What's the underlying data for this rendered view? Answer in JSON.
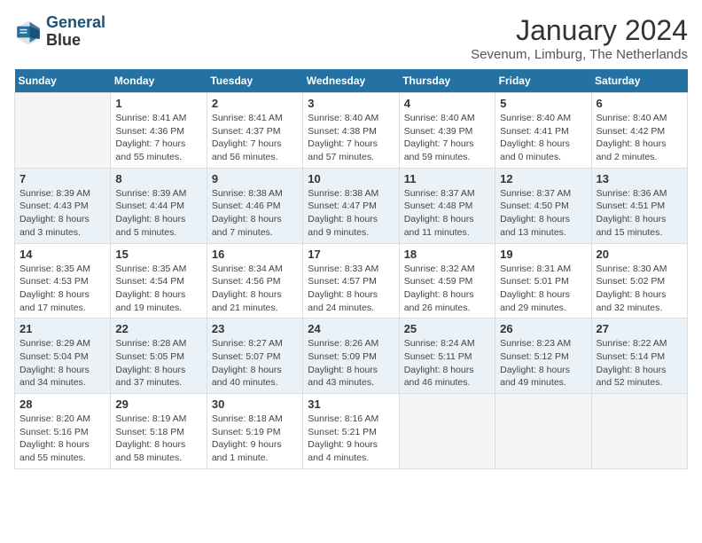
{
  "header": {
    "logo_line1": "General",
    "logo_line2": "Blue",
    "title": "January 2024",
    "subtitle": "Sevenum, Limburg, The Netherlands"
  },
  "days_of_week": [
    "Sunday",
    "Monday",
    "Tuesday",
    "Wednesday",
    "Thursday",
    "Friday",
    "Saturday"
  ],
  "weeks": [
    [
      {
        "day": "",
        "info": "",
        "empty": true
      },
      {
        "day": "1",
        "info": "Sunrise: 8:41 AM\nSunset: 4:36 PM\nDaylight: 7 hours\nand 55 minutes."
      },
      {
        "day": "2",
        "info": "Sunrise: 8:41 AM\nSunset: 4:37 PM\nDaylight: 7 hours\nand 56 minutes."
      },
      {
        "day": "3",
        "info": "Sunrise: 8:40 AM\nSunset: 4:38 PM\nDaylight: 7 hours\nand 57 minutes."
      },
      {
        "day": "4",
        "info": "Sunrise: 8:40 AM\nSunset: 4:39 PM\nDaylight: 7 hours\nand 59 minutes."
      },
      {
        "day": "5",
        "info": "Sunrise: 8:40 AM\nSunset: 4:41 PM\nDaylight: 8 hours\nand 0 minutes."
      },
      {
        "day": "6",
        "info": "Sunrise: 8:40 AM\nSunset: 4:42 PM\nDaylight: 8 hours\nand 2 minutes."
      }
    ],
    [
      {
        "day": "7",
        "info": "Sunrise: 8:39 AM\nSunset: 4:43 PM\nDaylight: 8 hours\nand 3 minutes."
      },
      {
        "day": "8",
        "info": "Sunrise: 8:39 AM\nSunset: 4:44 PM\nDaylight: 8 hours\nand 5 minutes."
      },
      {
        "day": "9",
        "info": "Sunrise: 8:38 AM\nSunset: 4:46 PM\nDaylight: 8 hours\nand 7 minutes."
      },
      {
        "day": "10",
        "info": "Sunrise: 8:38 AM\nSunset: 4:47 PM\nDaylight: 8 hours\nand 9 minutes."
      },
      {
        "day": "11",
        "info": "Sunrise: 8:37 AM\nSunset: 4:48 PM\nDaylight: 8 hours\nand 11 minutes."
      },
      {
        "day": "12",
        "info": "Sunrise: 8:37 AM\nSunset: 4:50 PM\nDaylight: 8 hours\nand 13 minutes."
      },
      {
        "day": "13",
        "info": "Sunrise: 8:36 AM\nSunset: 4:51 PM\nDaylight: 8 hours\nand 15 minutes."
      }
    ],
    [
      {
        "day": "14",
        "info": "Sunrise: 8:35 AM\nSunset: 4:53 PM\nDaylight: 8 hours\nand 17 minutes."
      },
      {
        "day": "15",
        "info": "Sunrise: 8:35 AM\nSunset: 4:54 PM\nDaylight: 8 hours\nand 19 minutes."
      },
      {
        "day": "16",
        "info": "Sunrise: 8:34 AM\nSunset: 4:56 PM\nDaylight: 8 hours\nand 21 minutes."
      },
      {
        "day": "17",
        "info": "Sunrise: 8:33 AM\nSunset: 4:57 PM\nDaylight: 8 hours\nand 24 minutes."
      },
      {
        "day": "18",
        "info": "Sunrise: 8:32 AM\nSunset: 4:59 PM\nDaylight: 8 hours\nand 26 minutes."
      },
      {
        "day": "19",
        "info": "Sunrise: 8:31 AM\nSunset: 5:01 PM\nDaylight: 8 hours\nand 29 minutes."
      },
      {
        "day": "20",
        "info": "Sunrise: 8:30 AM\nSunset: 5:02 PM\nDaylight: 8 hours\nand 32 minutes."
      }
    ],
    [
      {
        "day": "21",
        "info": "Sunrise: 8:29 AM\nSunset: 5:04 PM\nDaylight: 8 hours\nand 34 minutes."
      },
      {
        "day": "22",
        "info": "Sunrise: 8:28 AM\nSunset: 5:05 PM\nDaylight: 8 hours\nand 37 minutes."
      },
      {
        "day": "23",
        "info": "Sunrise: 8:27 AM\nSunset: 5:07 PM\nDaylight: 8 hours\nand 40 minutes."
      },
      {
        "day": "24",
        "info": "Sunrise: 8:26 AM\nSunset: 5:09 PM\nDaylight: 8 hours\nand 43 minutes."
      },
      {
        "day": "25",
        "info": "Sunrise: 8:24 AM\nSunset: 5:11 PM\nDaylight: 8 hours\nand 46 minutes."
      },
      {
        "day": "26",
        "info": "Sunrise: 8:23 AM\nSunset: 5:12 PM\nDaylight: 8 hours\nand 49 minutes."
      },
      {
        "day": "27",
        "info": "Sunrise: 8:22 AM\nSunset: 5:14 PM\nDaylight: 8 hours\nand 52 minutes."
      }
    ],
    [
      {
        "day": "28",
        "info": "Sunrise: 8:20 AM\nSunset: 5:16 PM\nDaylight: 8 hours\nand 55 minutes."
      },
      {
        "day": "29",
        "info": "Sunrise: 8:19 AM\nSunset: 5:18 PM\nDaylight: 8 hours\nand 58 minutes."
      },
      {
        "day": "30",
        "info": "Sunrise: 8:18 AM\nSunset: 5:19 PM\nDaylight: 9 hours\nand 1 minute."
      },
      {
        "day": "31",
        "info": "Sunrise: 8:16 AM\nSunset: 5:21 PM\nDaylight: 9 hours\nand 4 minutes."
      },
      {
        "day": "",
        "info": "",
        "empty": true
      },
      {
        "day": "",
        "info": "",
        "empty": true
      },
      {
        "day": "",
        "info": "",
        "empty": true
      }
    ]
  ]
}
